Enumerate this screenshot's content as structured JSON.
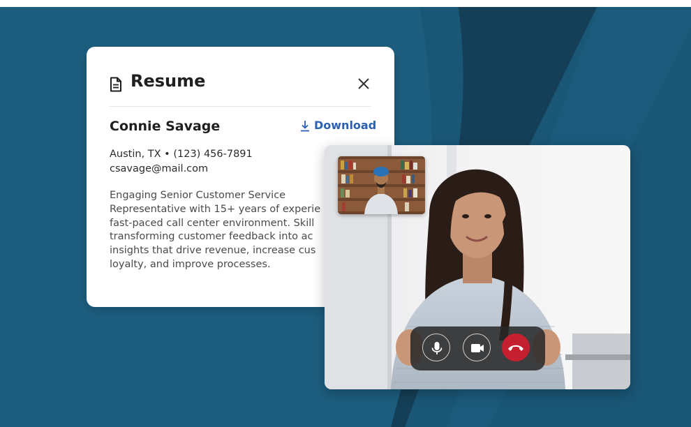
{
  "resume": {
    "title": "Resume",
    "name": "Connie Savage",
    "download_label": "Download",
    "contact_line1": "Austin, TX • (123) 456-7891",
    "contact_line2": "csavage@mail.com",
    "summary_lines": [
      "Engaging Senior Customer Service",
      "Representative with 15+ years of experie",
      "fast-paced call center environment. Skill",
      "transforming customer feedback into ac",
      "insights that drive revenue, increase cus",
      "loyalty, and improve processes."
    ]
  },
  "icons": {
    "document": "document-icon",
    "close": "close-icon",
    "download": "download-icon",
    "microphone": "microphone-icon",
    "camera": "video-camera-icon",
    "end_call": "phone-hangup-icon"
  },
  "colors": {
    "background": "#1d5e7f",
    "background_dark": "#153f57",
    "card": "#ffffff",
    "link": "#2b5fb0",
    "end_call": "#c5202f",
    "controls_bar": "#282828"
  }
}
